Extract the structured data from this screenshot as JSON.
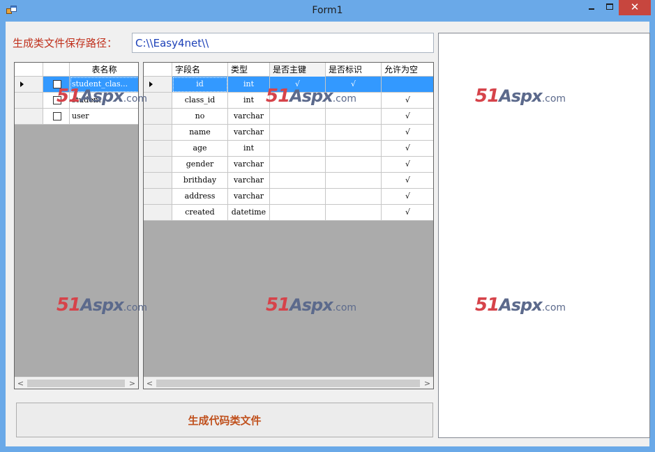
{
  "window": {
    "title": "Form1",
    "minimize_glyph": "",
    "maximize_glyph": "",
    "close_glyph": "✕"
  },
  "form": {
    "path_label": "生成类文件保存路径：",
    "path_value": "C:\\\\Easy4net\\\\"
  },
  "tables_grid": {
    "header": "表名称",
    "rows": [
      {
        "checked": false,
        "name": "student_clas...",
        "selected": true
      },
      {
        "checked": false,
        "name": "student",
        "selected": false
      },
      {
        "checked": false,
        "name": "user",
        "selected": false
      }
    ]
  },
  "fields_grid": {
    "headers": [
      "字段名",
      "类型",
      "是否主键",
      "是否标识",
      "允许为空"
    ],
    "rows": [
      {
        "field": "id",
        "type": "int",
        "pk": "√",
        "identity": "√",
        "nullable": "",
        "selected": true
      },
      {
        "field": "class_id",
        "type": "int",
        "pk": "",
        "identity": "",
        "nullable": "√",
        "selected": false
      },
      {
        "field": "no",
        "type": "varchar",
        "pk": "",
        "identity": "",
        "nullable": "√",
        "selected": false
      },
      {
        "field": "name",
        "type": "varchar",
        "pk": "",
        "identity": "",
        "nullable": "√",
        "selected": false
      },
      {
        "field": "age",
        "type": "int",
        "pk": "",
        "identity": "",
        "nullable": "√",
        "selected": false
      },
      {
        "field": "gender",
        "type": "varchar",
        "pk": "",
        "identity": "",
        "nullable": "√",
        "selected": false
      },
      {
        "field": "brithday",
        "type": "varchar",
        "pk": "",
        "identity": "",
        "nullable": "√",
        "selected": false
      },
      {
        "field": "address",
        "type": "varchar",
        "pk": "",
        "identity": "",
        "nullable": "√",
        "selected": false
      },
      {
        "field": "created",
        "type": "datetime",
        "pk": "",
        "identity": "",
        "nullable": "√",
        "selected": false
      }
    ]
  },
  "scroll": {
    "left_arrow": "<",
    "right_arrow": ">"
  },
  "generate_button": "生成代码类文件",
  "watermark": {
    "part1": "51",
    "part2": "Aspx",
    "part3": ".com"
  }
}
